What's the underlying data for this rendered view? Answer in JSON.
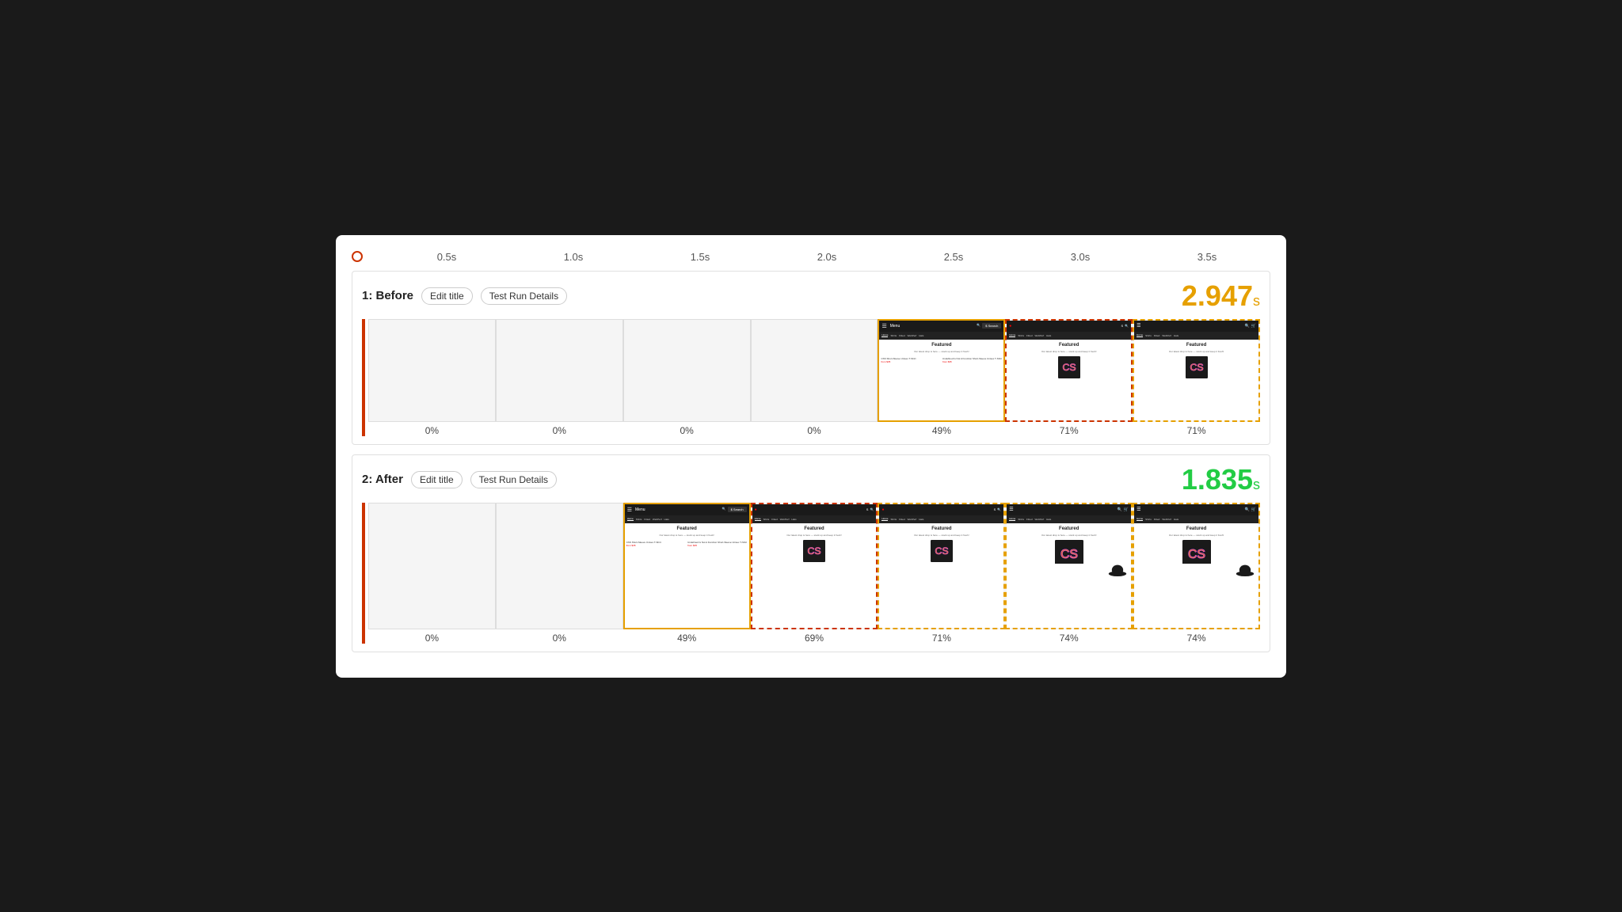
{
  "timeline": {
    "marks": [
      "0.5s",
      "1.0s",
      "1.5s",
      "2.0s",
      "2.5s",
      "3.0s",
      "3.5s"
    ]
  },
  "section1": {
    "label": "1: Before",
    "edit_title_label": "Edit title",
    "test_run_label": "Test Run Details",
    "score": "2.947",
    "score_unit": "s",
    "score_class": "score-orange",
    "frames": [
      {
        "pct": "0%",
        "type": "empty"
      },
      {
        "pct": "0%",
        "type": "empty"
      },
      {
        "pct": "0%",
        "type": "empty"
      },
      {
        "pct": "0%",
        "type": "empty"
      },
      {
        "pct": "49%",
        "type": "browser",
        "border": "active-orange"
      },
      {
        "pct": "71%",
        "type": "browser-tshirt",
        "border": "active-red-dashed"
      },
      {
        "pct": "71%",
        "type": "browser-tshirt",
        "border": "active-orange-dashed"
      }
    ]
  },
  "section2": {
    "label": "2: After",
    "edit_title_label": "Edit title",
    "test_run_label": "Test Run Details",
    "score": "1.835",
    "score_unit": "s",
    "score_class": "score-green",
    "frames": [
      {
        "pct": "0%",
        "type": "empty"
      },
      {
        "pct": "0%",
        "type": "empty"
      },
      {
        "pct": "49%",
        "type": "browser",
        "border": "active-orange"
      },
      {
        "pct": "69%",
        "type": "browser-tshirt",
        "border": "active-red-dashed"
      },
      {
        "pct": "71%",
        "type": "browser-tshirt",
        "border": "active-orange-dashed"
      },
      {
        "pct": "74%",
        "type": "browser-tshirt-partial",
        "border": "active-orange-dashed"
      },
      {
        "pct": "74%",
        "type": "browser-tshirt-partial",
        "border": "active-orange-dashed"
      }
    ]
  }
}
